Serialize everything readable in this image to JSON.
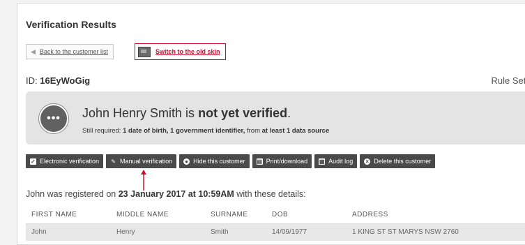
{
  "page": {
    "title": "Verification Results",
    "back_button": "Back to the customer list",
    "skin_button": "Switch to the old skin",
    "id_label": "ID:",
    "id_value": "16EyWoGig",
    "ruleset_label": "Rule Set: R"
  },
  "status": {
    "icon": "ellipsis-icon",
    "name": "John Henry Smith is",
    "state": "not yet verified",
    "period": ".",
    "sub_prefix": "Still required:",
    "sub_required": "1 date of birth, 1 government identifier,",
    "sub_from": "from",
    "sub_source": "at least 1 data source"
  },
  "toolbar": [
    {
      "label": "Electronic verification",
      "icon": "checkbox-icon"
    },
    {
      "label": "Manual verification",
      "icon": "edit-icon"
    },
    {
      "label": "Hide this customer",
      "icon": "eye-icon"
    },
    {
      "label": "Print/download",
      "icon": "print-icon"
    },
    {
      "label": "Audit log",
      "icon": "calendar-icon"
    },
    {
      "label": "Delete this customer",
      "icon": "delete-icon"
    }
  ],
  "registration": {
    "prefix": "John was registered on",
    "date": "23 January 2017 at 10:59AM",
    "suffix": "with these details:"
  },
  "table": {
    "headers": [
      "FIRST NAME",
      "MIDDLE NAME",
      "SURNAME",
      "DOB",
      "ADDRESS"
    ],
    "rows": [
      [
        "John",
        "Henry",
        "Smith",
        "14/09/1977",
        "1 KING ST ST MARYS NSW 2760"
      ]
    ]
  },
  "colors": {
    "accent_red": "#c8102e",
    "toolbar_bg": "#4a4a4a",
    "status_bg": "#e4e4e4"
  }
}
